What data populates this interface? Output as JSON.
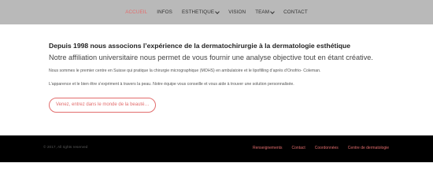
{
  "nav": {
    "items": [
      {
        "label": "ACCUEIL",
        "active": true
      },
      {
        "label": "INFOS"
      },
      {
        "label": "ESTHETIQUE",
        "dropdown": true
      },
      {
        "label": "VISION"
      },
      {
        "label": "TEAM",
        "dropdown": true
      },
      {
        "label": "CONTACT"
      }
    ]
  },
  "main": {
    "headline": "Depuis 1998 nous associons l’expérience de la dermatochirurgie à la dermatologie esthétique",
    "subheadline": "Notre affiliation universitaire nous permet de vous fournir une analyse objective tout en étant créative.",
    "para1": "Nous sommes le premier centre en Suisse qui pratique la chirurgie micrographique (MOHS) en ambulatoire et le lipofilling d’après d’Onofrio- Coleman.",
    "para2": "L’apparence et le bien être s’expriment à travers la peau. Notre équipe vous conseille et vous aide à trouver une solution personnalisée.",
    "cta_label": "Venez, entrez dans le monde de la beauté…"
  },
  "footer": {
    "copyright": "© 2017, All rights reserved",
    "links": [
      "Renseignements",
      "Contact",
      "Coordonnées",
      "Centre de dermatologie"
    ]
  },
  "colors": {
    "accent": "#e26d6d",
    "nav_bg": "#b9b9b9",
    "footer_bg": "#000000"
  }
}
